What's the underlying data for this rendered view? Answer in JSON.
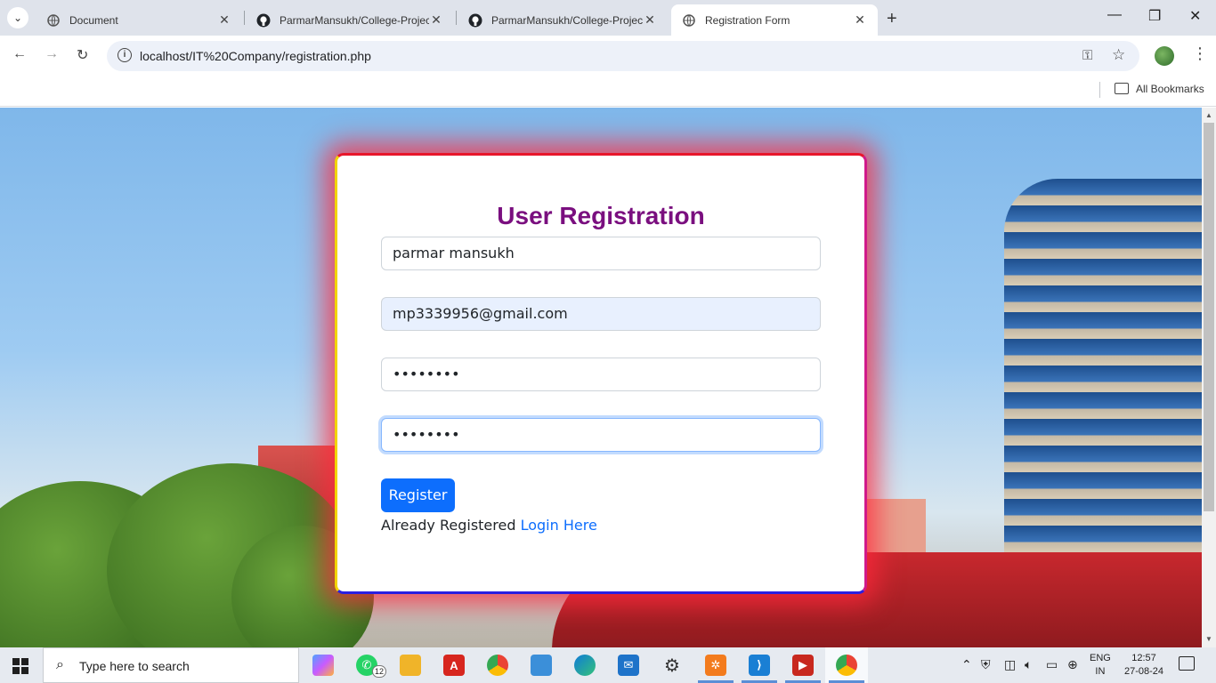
{
  "browser": {
    "tabs": [
      {
        "label": "Document",
        "icon": "globe-icon",
        "active": false
      },
      {
        "label": "ParmarMansukh/College-Projec",
        "icon": "github-icon",
        "active": false
      },
      {
        "label": "ParmarMansukh/College-Projec",
        "icon": "github-icon",
        "active": false
      },
      {
        "label": "Registration Form",
        "icon": "globe-icon",
        "active": true
      }
    ],
    "url": "localhost/IT%20Company/registration.php",
    "bookmarks_label": "All Bookmarks"
  },
  "form": {
    "title": "User Registration",
    "name_value": "parmar mansukh",
    "email_value": "mp3339956@gmail.com",
    "password_value": "••••••••",
    "confirm_value": "••••••••",
    "register_label": "Register",
    "already_text": "Already Registered",
    "login_link": "Login Here"
  },
  "taskbar": {
    "search_placeholder": "Type here to search",
    "whatsapp_badge": "12",
    "lang_line1": "ENG",
    "lang_line2": "IN",
    "time": "12:57",
    "date": "27-08-24"
  },
  "colors": {
    "title": "#7a0f7f",
    "primary": "#0d6efd",
    "card_glow": "#ff283c"
  }
}
